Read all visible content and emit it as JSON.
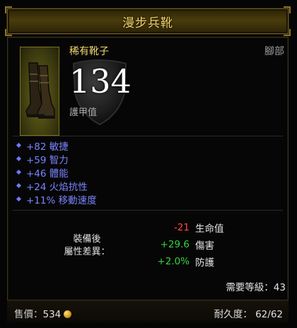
{
  "item": {
    "name": "漫步兵靴",
    "type": "稀有靴子",
    "slot": "腳部",
    "armor_value": "134",
    "armor_label": "護甲值",
    "icon": "boots-icon"
  },
  "affixes": [
    "+82 敏捷",
    "+59 智力",
    "+46 體能",
    "+24 火焰抗性",
    "+11% 移動速度"
  ],
  "comparison": {
    "label_line1": "裝備後",
    "label_line2": "屬性差異：",
    "rows": [
      {
        "delta": "-21",
        "stat": "生命值",
        "sign": "neg"
      },
      {
        "delta": "+29.6",
        "stat": "傷害",
        "sign": "pos"
      },
      {
        "delta": "+2.0%",
        "stat": "防護",
        "sign": "pos"
      }
    ]
  },
  "requirement": "需要等級：43",
  "footer": {
    "sell_label": "售價：",
    "sell_value": "534",
    "durability_label": "耐久度：",
    "durability_value": "62/62"
  },
  "colors": {
    "title": "#f0d26a",
    "affix": "#7b84ff",
    "negative": "#ff4a3c",
    "positive": "#35d43e"
  }
}
